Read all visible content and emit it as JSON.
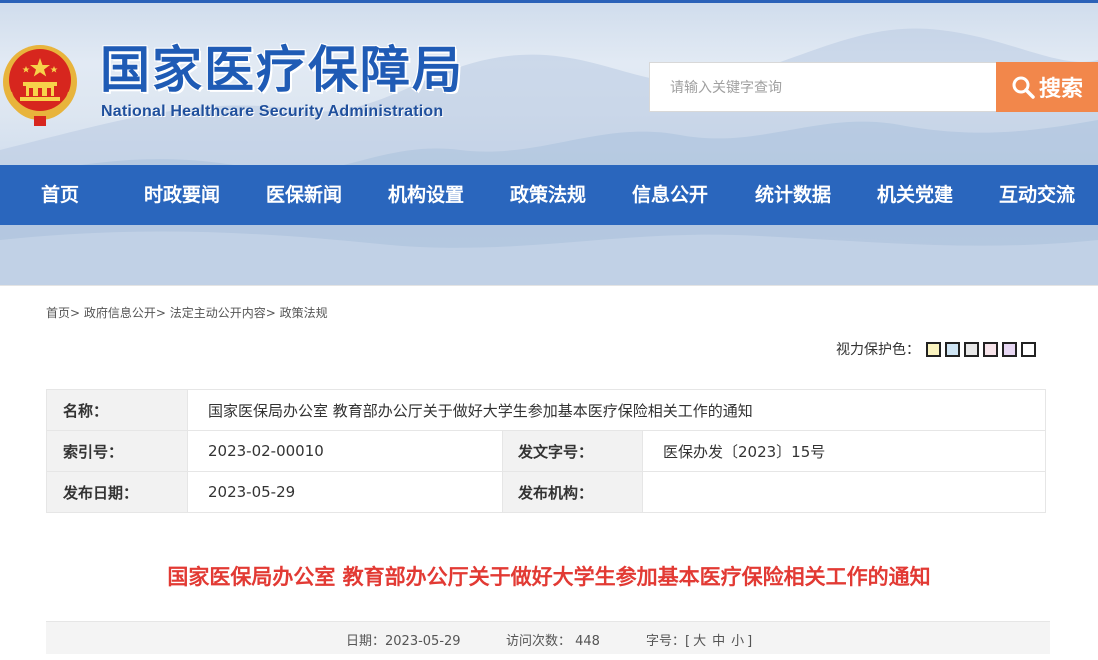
{
  "header": {
    "title": "国家医疗保障局",
    "subtitle": "National Healthcare Security Administration",
    "search_placeholder": "请输入关键字查询",
    "search_button": "搜索"
  },
  "nav": {
    "items": [
      "首页",
      "时政要闻",
      "医保新闻",
      "机构设置",
      "政策法规",
      "信息公开",
      "统计数据",
      "机关党建",
      "互动交流"
    ]
  },
  "breadcrumb": {
    "items": [
      "首页>",
      "政府信息公开>",
      "法定主动公开内容>",
      "政策法规"
    ]
  },
  "eye_care": {
    "label": "视力保护色：",
    "swatches": [
      "#fbf4c0",
      "#cfe5f4",
      "#e8e8e8",
      "#f7e4ea",
      "#e7d7f3",
      "#ffffff"
    ]
  },
  "meta": {
    "name_label": "名称：",
    "name_value": "国家医保局办公室 教育部办公厅关于做好大学生参加基本医疗保险相关工作的通知",
    "index_label": "索引号：",
    "index_value": "2023-02-00010",
    "docno_label": "发文字号：",
    "docno_value": "医保办发〔2023〕15号",
    "date_label": "发布日期：",
    "date_value": "2023-05-29",
    "org_label": "发布机构：",
    "org_value": ""
  },
  "document": {
    "title": "国家医保局办公室 教育部办公厅关于做好大学生参加基本医疗保险相关工作的通知",
    "date_text": "日期：2023-05-29",
    "visits_text": "访问次数：  448",
    "fontsize_label": "字号：[",
    "fontsize_options": [
      "大",
      "中",
      "小"
    ],
    "fontsize_close": "]"
  },
  "colors": {
    "brand_blue": "#2a66bd",
    "title_red": "#e23a34",
    "search_orange": "#f2874b"
  }
}
